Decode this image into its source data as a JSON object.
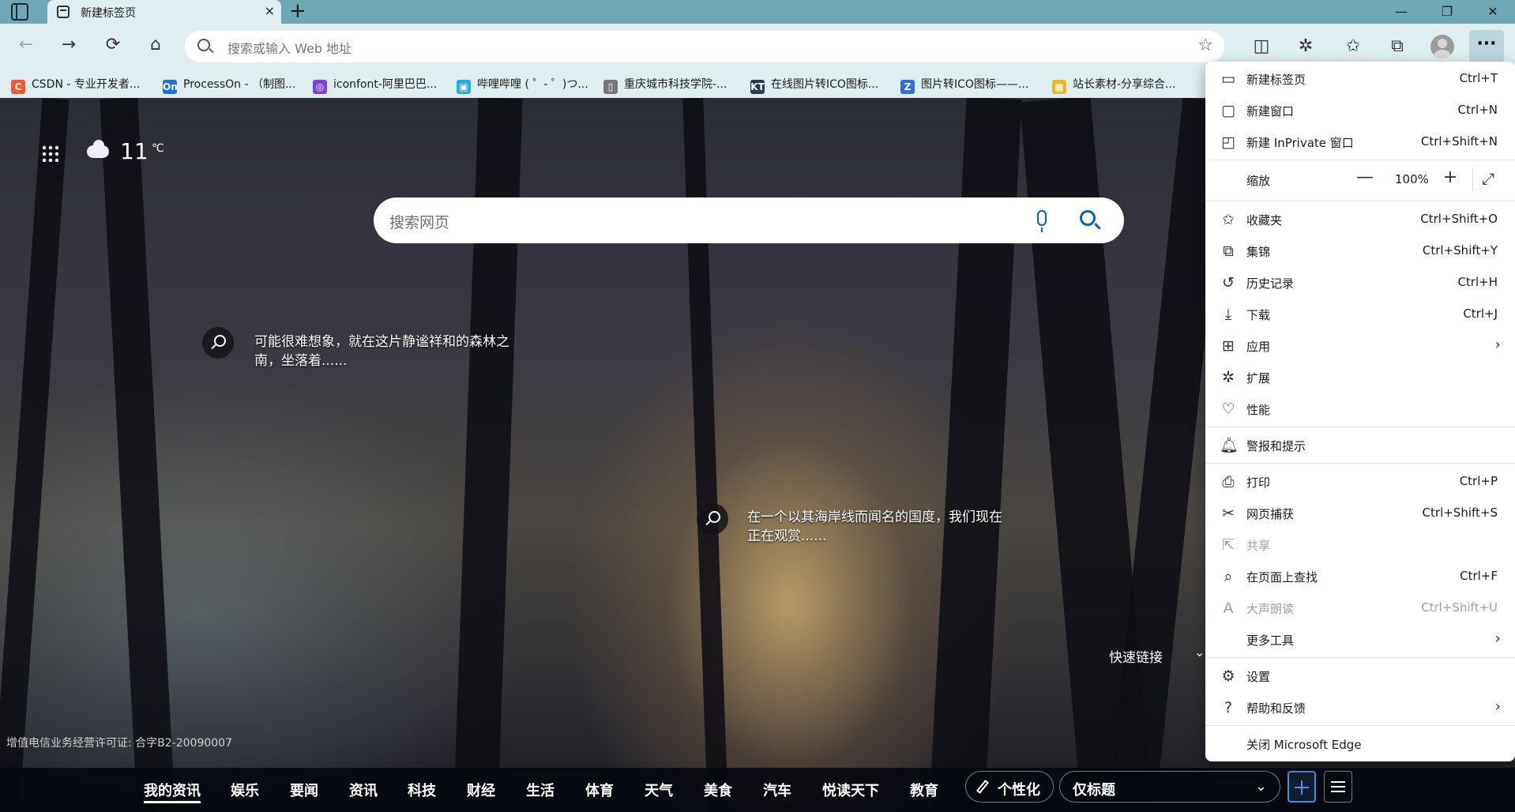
{
  "window": {
    "tab_title": "新建标签页",
    "tab_close": "×",
    "new_tab": "+",
    "minimize": "—",
    "restore": "❐",
    "close": "✕"
  },
  "toolbar": {
    "back": "←",
    "forward": "→",
    "refresh": "⟳",
    "home": "⌂",
    "address_placeholder": "搜索或输入 Web 地址",
    "fav_star": "☆",
    "more": "···"
  },
  "bookmarks": [
    {
      "label": "CSDN - 专业开发者...",
      "icon_text": "C",
      "color": "#fc5531"
    },
    {
      "label": "ProcessOn - （制图...",
      "icon_text": "On",
      "color": "#1c6ee8"
    },
    {
      "label": "iconfont-阿里巴巴...",
      "icon_text": "◎",
      "color": "#7b3fe4"
    },
    {
      "label": "哔哩哔哩 ( ゜- ゜)つ...",
      "icon_text": "▣",
      "color": "#23ade5"
    },
    {
      "label": "重庆城市科技学院-...",
      "icon_text": "▯",
      "color": "#777777"
    },
    {
      "label": "在线图片转ICO图标...",
      "icon_text": "KT",
      "color": "#2a3b55"
    },
    {
      "label": "图片转ICO图标——...",
      "icon_text": "Z",
      "color": "#2f6de1"
    },
    {
      "label": "站长素材-分享综合...",
      "icon_text": "▦",
      "color": "#e7b923"
    }
  ],
  "newtab": {
    "temperature": "11",
    "temp_unit": "℃",
    "search_placeholder": "搜索网页",
    "hotspots": [
      {
        "text": "可能很难想象，就在这片静谧祥和的森林之南，坐落着......"
      },
      {
        "text": "在一个以其海岸线而闻名的国度，我们现在正在观赏......"
      }
    ],
    "quick_links": "快速链接",
    "quick_links_chevron": "⌄",
    "license": "增值电信业务经营许可证: 合字B2-20090007"
  },
  "newsbar": {
    "tabs": [
      "我的资讯",
      "娱乐",
      "要闻",
      "资讯",
      "科技",
      "财经",
      "生活",
      "体育",
      "天气",
      "美食",
      "汽车",
      "悦读天下",
      "教育"
    ],
    "personalize": "个性化",
    "view_select": "仅标题",
    "view_chevron": "⌄"
  },
  "menu": {
    "new_tab": {
      "label": "新建标签页",
      "shortcut": "Ctrl+T"
    },
    "new_window": {
      "label": "新建窗口",
      "shortcut": "Ctrl+N"
    },
    "new_inprivate": {
      "label": "新建 InPrivate 窗口",
      "shortcut": "Ctrl+Shift+N"
    },
    "zoom": {
      "label": "缩放",
      "minus": "—",
      "value": "100%",
      "plus": "+",
      "fullscreen": "⤢"
    },
    "favorites": {
      "label": "收藏夹",
      "shortcut": "Ctrl+Shift+O"
    },
    "collections": {
      "label": "集锦",
      "shortcut": "Ctrl+Shift+Y"
    },
    "history": {
      "label": "历史记录",
      "shortcut": "Ctrl+H"
    },
    "downloads": {
      "label": "下载",
      "shortcut": "Ctrl+J"
    },
    "apps": {
      "label": "应用",
      "arrow": "›"
    },
    "extensions": {
      "label": "扩展"
    },
    "performance": {
      "label": "性能"
    },
    "alerts": {
      "label": "警报和提示"
    },
    "print": {
      "label": "打印",
      "shortcut": "Ctrl+P"
    },
    "web_capture": {
      "label": "网页捕获",
      "shortcut": "Ctrl+Shift+S"
    },
    "share": {
      "label": "共享"
    },
    "find": {
      "label": "在页面上查找",
      "shortcut": "Ctrl+F"
    },
    "read_aloud": {
      "label": "大声朗读",
      "shortcut": "Ctrl+Shift+U"
    },
    "more_tools": {
      "label": "更多工具",
      "arrow": "›"
    },
    "settings": {
      "label": "设置"
    },
    "help": {
      "label": "帮助和反馈",
      "arrow": "›"
    },
    "close_edge": {
      "label": "关闭 Microsoft Edge"
    }
  }
}
